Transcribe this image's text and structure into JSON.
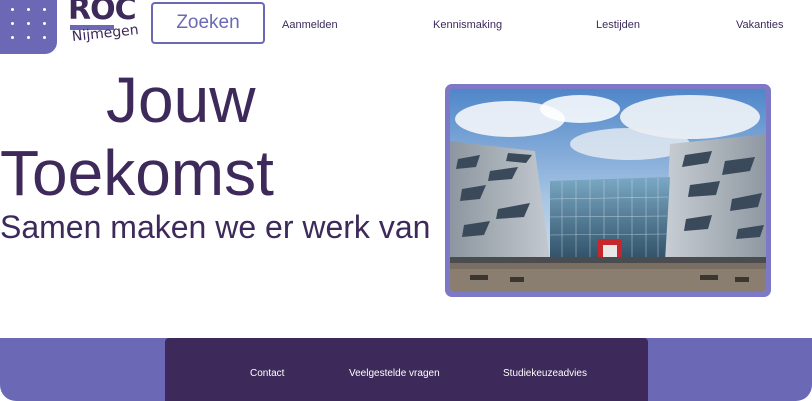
{
  "header": {
    "logo": {
      "brand": "ROC",
      "city": "Nijmegen"
    },
    "search_label": "Zoeken",
    "nav": [
      {
        "label": "Aanmelden"
      },
      {
        "label": "Kennismaking"
      },
      {
        "label": "Lestijden"
      },
      {
        "label": "Vakanties"
      }
    ]
  },
  "hero": {
    "title_line1": "Jouw",
    "title_line2": "Toekomst",
    "subtitle": "Samen maken we er werk van"
  },
  "footer": {
    "links": [
      {
        "label": "Contact"
      },
      {
        "label": "Veelgestelde vragen"
      },
      {
        "label": "Studiekeuzeadvies"
      }
    ]
  },
  "colors": {
    "brand_purple": "#6b69b6",
    "dark_purple": "#3d2a5a",
    "photo_border": "#7e79c6"
  }
}
